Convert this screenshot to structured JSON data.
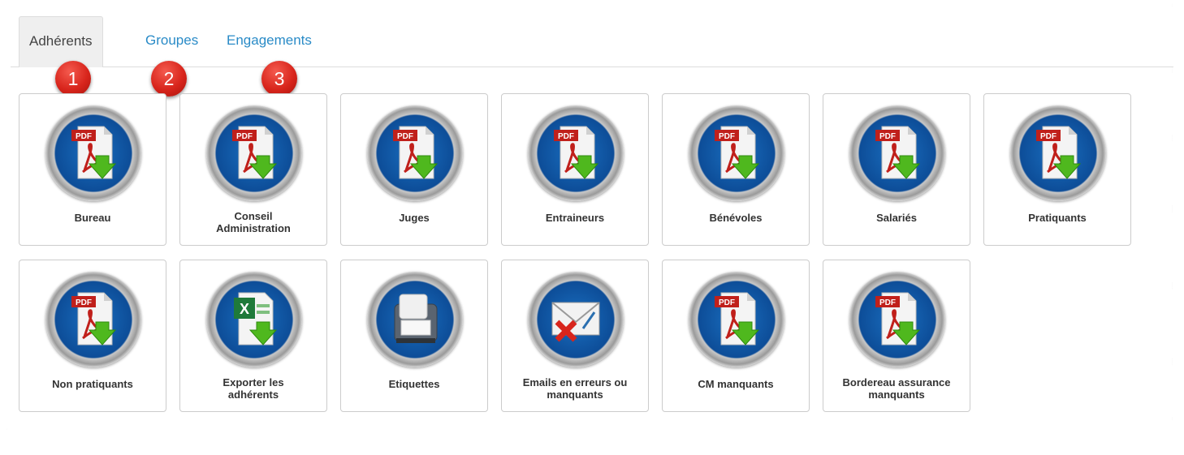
{
  "tabs": [
    {
      "label": "Adhérents",
      "active": true
    },
    {
      "label": "Groupes",
      "active": false
    },
    {
      "label": "Engagements",
      "active": false
    }
  ],
  "markers": [
    "1",
    "2",
    "3"
  ],
  "tiles": [
    {
      "label": "Bureau",
      "icon": "pdf-download-icon"
    },
    {
      "label": "Conseil\nAdministration",
      "icon": "pdf-download-icon"
    },
    {
      "label": "Juges",
      "icon": "pdf-download-icon"
    },
    {
      "label": "Entraineurs",
      "icon": "pdf-download-icon"
    },
    {
      "label": "Bénévoles",
      "icon": "pdf-download-icon"
    },
    {
      "label": "Salariés",
      "icon": "pdf-download-icon"
    },
    {
      "label": "Pratiquants",
      "icon": "pdf-download-icon"
    },
    {
      "label": "Non pratiquants",
      "icon": "pdf-download-icon"
    },
    {
      "label": "Exporter les\nadhérents",
      "icon": "excel-download-icon"
    },
    {
      "label": "Etiquettes",
      "icon": "label-printer-icon"
    },
    {
      "label": "Emails en erreurs ou\nmanquants",
      "icon": "email-error-icon"
    },
    {
      "label": "CM manquants",
      "icon": "pdf-download-icon"
    },
    {
      "label": "Bordereau assurance\nmanquants",
      "icon": "pdf-download-icon"
    }
  ],
  "icon_text": {
    "pdf": "PDF"
  },
  "colors": {
    "link": "#2a8bc7",
    "marker": "#d8251c",
    "icon_blue": "#0d4d98",
    "arrow_green": "#4fb81e"
  }
}
